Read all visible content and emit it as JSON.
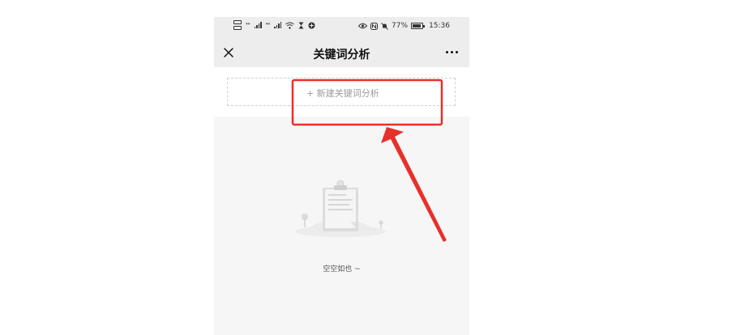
{
  "status_bar": {
    "signal1": "⁴⁶",
    "signal2": "⁴⁶",
    "battery_percent": "77%",
    "battery_level": 0.77,
    "time": "15:36",
    "icons": [
      "sim-icon",
      "signal-icon",
      "wifi-icon",
      "hourglass-icon",
      "vpn-icon",
      "eye-icon",
      "nfc-icon",
      "mute-icon",
      "battery-icon"
    ]
  },
  "navbar": {
    "title": "关键词分析",
    "close_icon": "close-icon",
    "more_icon": "more-icon"
  },
  "new_button": {
    "label": "+ 新建关键词分析"
  },
  "empty_state": {
    "text": "空空如也 ~",
    "illustration": "clipboard-icon"
  },
  "annotation": {
    "color": "#e8302a"
  }
}
